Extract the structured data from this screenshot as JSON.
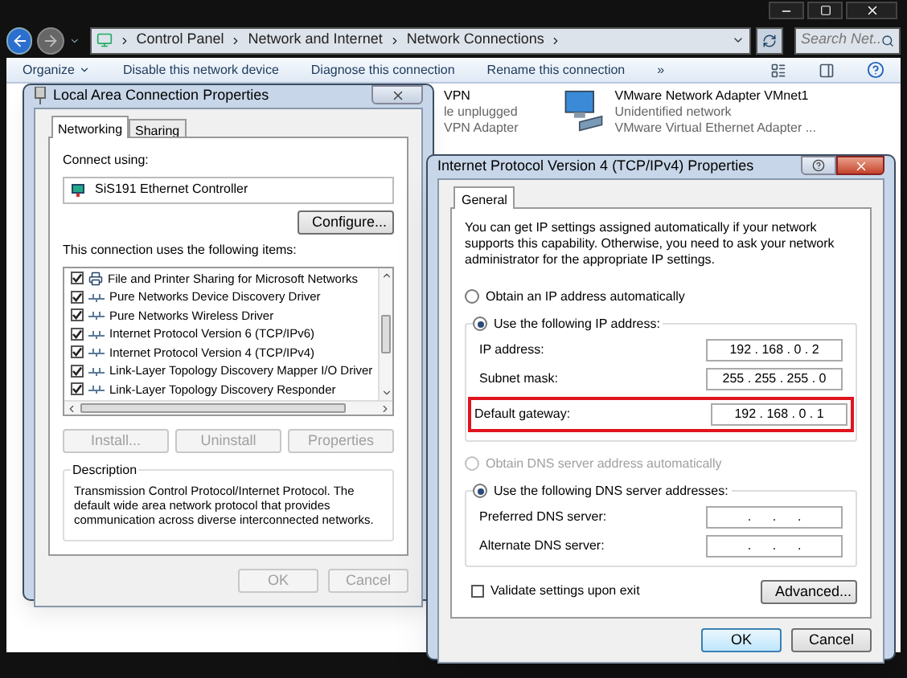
{
  "explorer": {
    "breadcrumb": [
      "Control Panel",
      "Network and Internet",
      "Network Connections"
    ],
    "search": {
      "placeholder": "Search Net..."
    },
    "toolbar": [
      {
        "label": "Organize",
        "kind": "menu"
      },
      {
        "label": "Disable this network device",
        "kind": "command"
      },
      {
        "label": "Diagnose this connection",
        "kind": "command"
      },
      {
        "label": "Rename this connection",
        "kind": "command"
      },
      {
        "label": "»",
        "kind": "overflow"
      }
    ],
    "connections": [
      {
        "name": "VPN",
        "status": "le unplugged",
        "adapter": "VPN Adapter",
        "kind": "partial"
      },
      {
        "name": "VMware Network Adapter VMnet1",
        "status": "Unidentified network",
        "adapter": "VMware Virtual Ethernet Adapter ...",
        "kind": "full"
      }
    ]
  },
  "lan_dialog": {
    "title": "Local Area Connection Properties",
    "tabs": [
      {
        "label": "Networking",
        "selected": true
      },
      {
        "label": "Sharing",
        "selected": false
      }
    ],
    "connect_using_label": "Connect using:",
    "adapter": "SiS191 Ethernet Controller",
    "configure_button": "Configure...",
    "items_label": "This connection uses the following items:",
    "items": [
      {
        "label": "File and Printer Sharing for Microsoft Networks",
        "checked": true,
        "kind": "service"
      },
      {
        "label": "Pure Networks Device Discovery Driver",
        "checked": true,
        "kind": "protocol"
      },
      {
        "label": "Pure Networks Wireless Driver",
        "checked": true,
        "kind": "protocol"
      },
      {
        "label": "Internet Protocol Version 6 (TCP/IPv6)",
        "checked": true,
        "kind": "protocol"
      },
      {
        "label": "Internet Protocol Version 4 (TCP/IPv4)",
        "checked": true,
        "kind": "protocol"
      },
      {
        "label": "Link-Layer Topology Discovery Mapper I/O Driver",
        "checked": true,
        "kind": "protocol"
      },
      {
        "label": "Link-Layer Topology Discovery Responder",
        "checked": true,
        "kind": "protocol"
      }
    ],
    "item_buttons": [
      {
        "label": "Install...",
        "disabled": true
      },
      {
        "label": "Uninstall",
        "disabled": true
      },
      {
        "label": "Properties",
        "disabled": true
      }
    ],
    "description": {
      "title": "Description",
      "text": "Transmission Control Protocol/Internet Protocol. The default wide area network protocol that provides communication across diverse interconnected networks."
    },
    "buttons": [
      {
        "label": "OK",
        "disabled": true
      },
      {
        "label": "Cancel",
        "disabled": true
      }
    ]
  },
  "ipv4_dialog": {
    "title": "Internet Protocol Version 4 (TCP/IPv4) Properties",
    "tabs": [
      {
        "label": "General",
        "selected": true
      }
    ],
    "intro": "You can get IP settings assigned automatically if your network supports this capability. Otherwise, you need to ask your network administrator for the appropriate IP settings.",
    "ip_mode": [
      {
        "label": "Obtain an IP address automatically",
        "selected": false
      },
      {
        "label": "Use the following IP address:",
        "selected": true
      }
    ],
    "ip_fields": [
      {
        "label": "IP address:",
        "value": "192 . 168 . 0 . 2",
        "highlighted": false
      },
      {
        "label": "Subnet mask:",
        "value": "255 . 255 . 255 . 0",
        "highlighted": false
      },
      {
        "label": "Default gateway:",
        "value": "192 . 168 . 0 . 1",
        "highlighted": true
      }
    ],
    "dns_mode": [
      {
        "label": "Obtain DNS server address automatically",
        "selected": false,
        "disabled": true
      },
      {
        "label": "Use the following DNS server addresses:",
        "selected": true,
        "disabled": false
      }
    ],
    "dns_fields": [
      {
        "label": "Preferred DNS server:",
        "value": ".      .      ."
      },
      {
        "label": "Alternate DNS server:",
        "value": ".      .      ."
      }
    ],
    "validate": {
      "label": "Validate settings upon exit",
      "checked": false
    },
    "advanced_button": "Advanced...",
    "buttons": [
      {
        "label": "OK",
        "default": true
      },
      {
        "label": "Cancel",
        "default": false
      }
    ]
  }
}
